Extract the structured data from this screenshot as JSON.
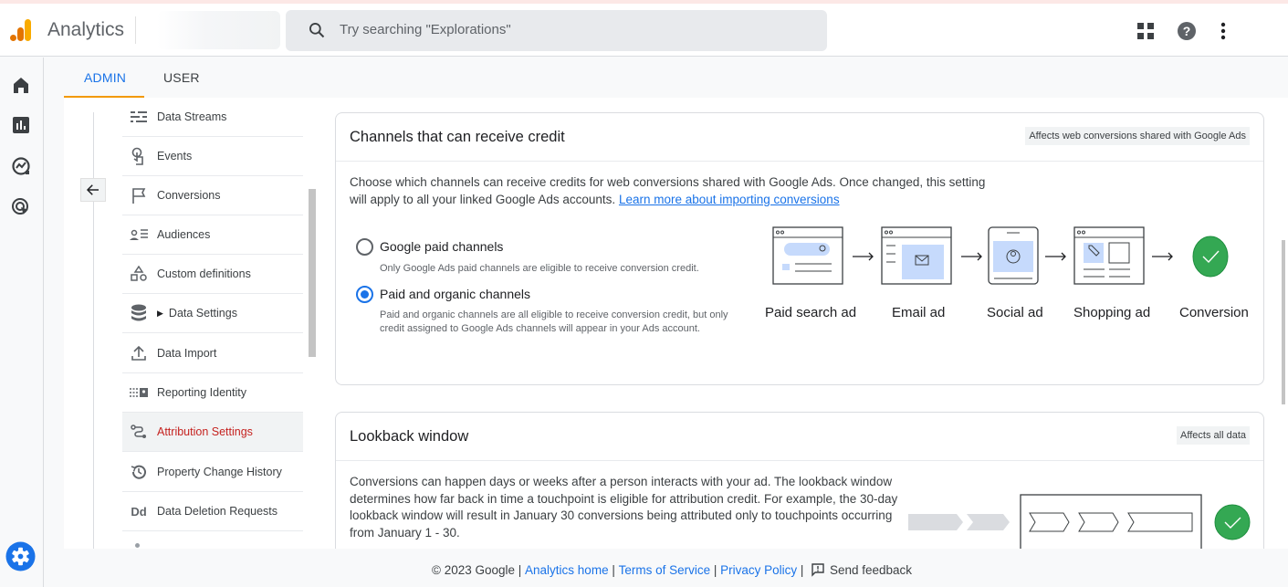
{
  "header": {
    "app_title": "Analytics",
    "search_placeholder": "Try searching \"Explorations\"",
    "icons": [
      "apps-grid-icon",
      "help-icon",
      "more-vert-icon"
    ]
  },
  "rail": {
    "items": [
      "home-icon",
      "reports-icon",
      "explore-icon",
      "advertising-icon"
    ],
    "settings_icon": "admin-gear-icon"
  },
  "tabs": [
    {
      "label": "ADMIN",
      "active": true
    },
    {
      "label": "USER",
      "active": false
    }
  ],
  "nav": {
    "items": [
      {
        "label": "Data Streams",
        "icon": "data-streams-icon"
      },
      {
        "label": "Events",
        "icon": "touch-icon"
      },
      {
        "label": "Conversions",
        "icon": "flag-icon"
      },
      {
        "label": "Audiences",
        "icon": "audiences-icon"
      },
      {
        "label": "Custom definitions",
        "icon": "shapes-icon"
      },
      {
        "label": "Data Settings",
        "icon": "database-icon",
        "expandable": true
      },
      {
        "label": "Data Import",
        "icon": "upload-icon"
      },
      {
        "label": "Reporting Identity",
        "icon": "identity-icon"
      },
      {
        "label": "Attribution Settings",
        "icon": "attribution-icon",
        "active": true
      },
      {
        "label": "Property Change History",
        "icon": "history-icon"
      },
      {
        "label": "Data Deletion Requests",
        "icon": "dd-icon",
        "icon_text": "Dd"
      }
    ]
  },
  "channels_card": {
    "title": "Channels that can receive credit",
    "chip": "Affects web conversions shared with Google Ads",
    "description": "Choose which channels can receive credits for web conversions shared with Google Ads. Once changed, this setting will apply to all your linked Google Ads accounts.",
    "link": "Learn more about importing conversions",
    "options": [
      {
        "label": "Google paid channels",
        "help": "Only Google Ads paid channels are eligible to receive conversion credit.",
        "selected": false
      },
      {
        "label": "Paid and organic channels",
        "help": "Paid and organic channels are all eligible to receive conversion credit, but only credit assigned to Google Ads channels will appear in your Ads account.",
        "selected": true
      }
    ],
    "flow": [
      "Paid search ad",
      "Email ad",
      "Social ad",
      "Shopping ad",
      "Conversion"
    ]
  },
  "lookback_card": {
    "title": "Lookback window",
    "chip": "Affects all data",
    "description": "Conversions can happen days or weeks after a person interacts with your ad. The lookback window determines how far back in time a touchpoint is eligible for attribution credit. For example, the 30-day lookback window will result in January 30 conversions being attributed only to touchpoints occurring from January 1 - 30."
  },
  "footer": {
    "copyright": "© 2023 Google",
    "links": [
      "Analytics home",
      "Terms of Service",
      "Privacy Policy"
    ],
    "feedback": "Send feedback"
  },
  "colors": {
    "accent": "#1a73e8",
    "tab_ink": "#f29900",
    "active_nav": "#c5221f",
    "conversion_green": "#34a853"
  }
}
